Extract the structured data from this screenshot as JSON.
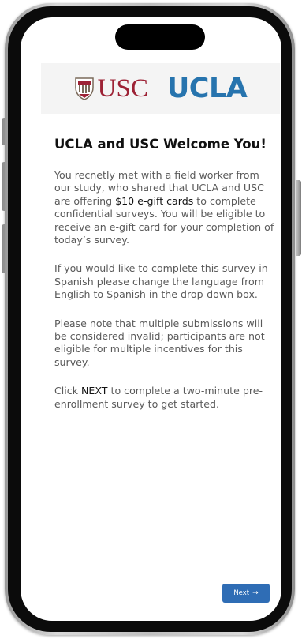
{
  "logos": {
    "usc": "USC",
    "ucla": "UCLA",
    "usc_color": "#9d2235",
    "ucla_color": "#2774ae"
  },
  "heading": "UCLA and USC Welcome You!",
  "paragraphs": {
    "p1_before": "You recnetly met with a field worker from our study, who shared that UCLA and USC are offering ",
    "p1_highlight": "$10 e-gift cards",
    "p1_after": " to complete confidential surveys. You will be eligible to receive an e-gift card for your completion of today’s survey.",
    "p2": "If you would like to complete this survey in Spanish please change the language from English to Spanish in the drop-down box.",
    "p3": "Please note that multiple submissions will be considered invalid; participants are not eligible for multiple incentives for this survey.",
    "p4_before": "Click ",
    "p4_highlight": "NEXT",
    "p4_after": " to complete a two-minute pre-enrollment survey to get started."
  },
  "next_button": {
    "label": "Next",
    "icon": "arrow-right-icon",
    "arrow": "→",
    "color": "#2f6db5"
  }
}
